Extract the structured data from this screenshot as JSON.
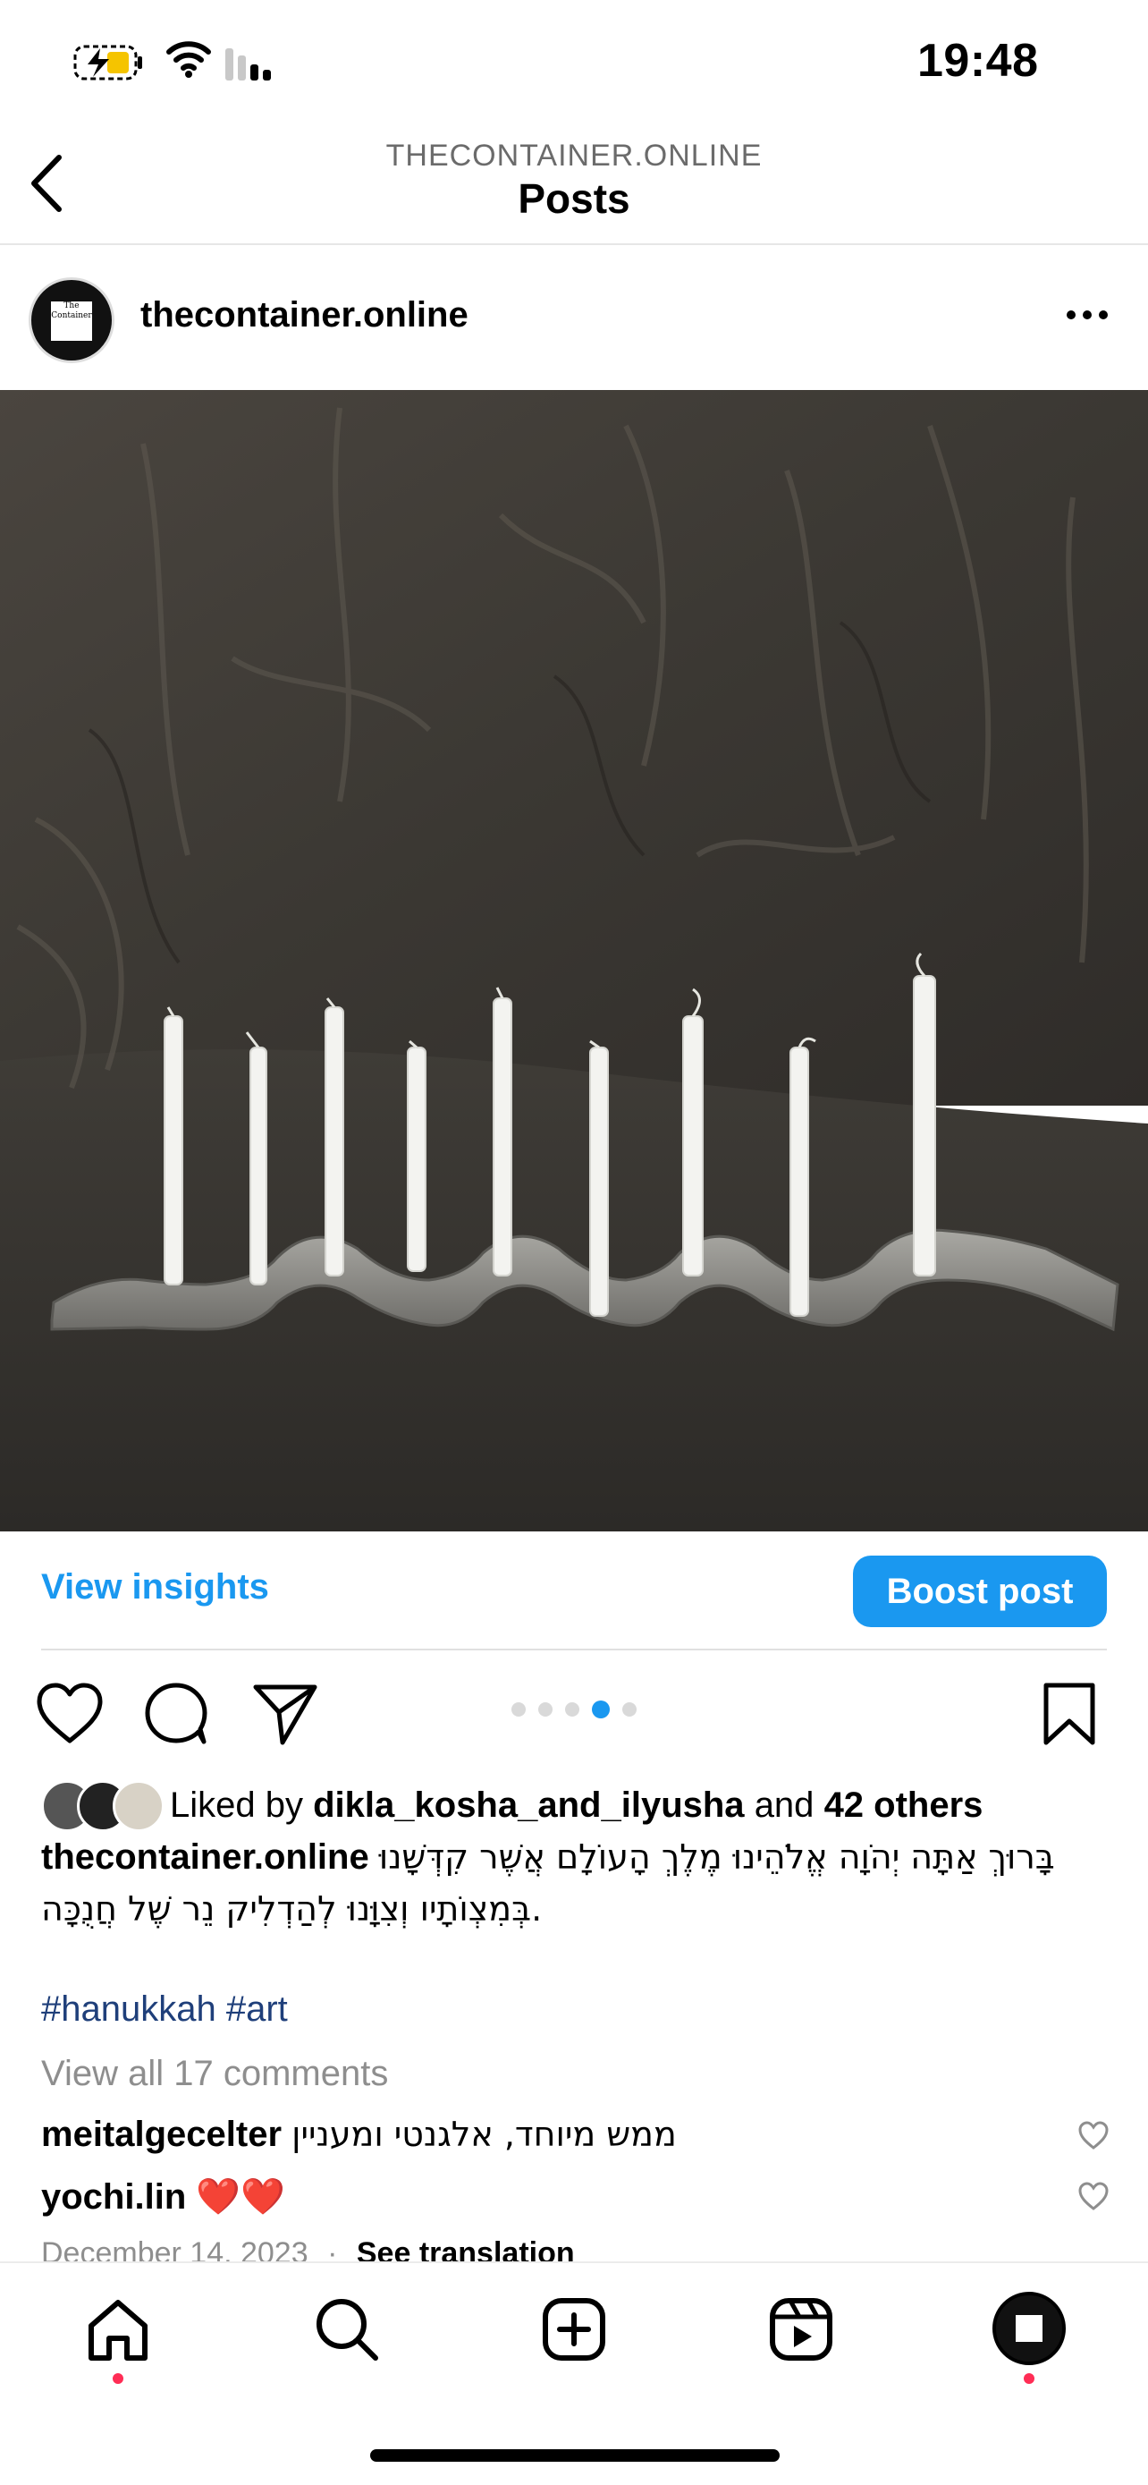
{
  "status_bar": {
    "time": "19:48"
  },
  "header": {
    "subtitle": "THECONTAINER.ONLINE",
    "title": "Posts"
  },
  "post": {
    "username": "thecontainer.online",
    "avatar_text": "The Container",
    "insights_label": "View insights",
    "boost_label": "Boost post",
    "carousel": {
      "count": 5,
      "active_index": 3
    },
    "likes": {
      "prefix": "Liked by",
      "user": "dikla_kosha_and_ilyusha",
      "and": "and",
      "others": "42 others"
    },
    "caption": {
      "username": "thecontainer.online",
      "line1": "בָּרוּךְ אַתָּה יְהֹוָה אֱלֹהֵינוּ מֶלֶךְ הָעוֹלָם אֲשֶׁר קִדְּשָׁנוּ",
      "line2": "בְּמִצְוֹתָיו וְצִוָּנוּ לְהַדְלִיק נֵר שֶׁל חֲנֻכָּה."
    },
    "hashtags": "#hanukkah #art",
    "view_comments": "View all 17 comments",
    "comments": [
      {
        "user": "meitalgecelter",
        "text": "ממש מיוחד, אלגנטי ומעניין"
      },
      {
        "user": "yochi.lin",
        "text": "❤️❤️"
      }
    ],
    "date": "December 14, 2023",
    "separator": "·",
    "translation": "See translation"
  },
  "icons": {
    "back": "chevron-left-icon",
    "more": "more-horizontal-icon",
    "heart": "heart-icon",
    "comment": "comment-icon",
    "share": "send-icon",
    "save": "bookmark-icon",
    "home": "home-icon",
    "search": "search-icon",
    "create": "plus-square-icon",
    "reels": "reels-icon",
    "profile": "profile-avatar"
  },
  "colors": {
    "accent": "#1a98f0",
    "hashtag": "#1f3f7a",
    "muted": "#8e8e8e",
    "notification": "#ff2d55"
  }
}
